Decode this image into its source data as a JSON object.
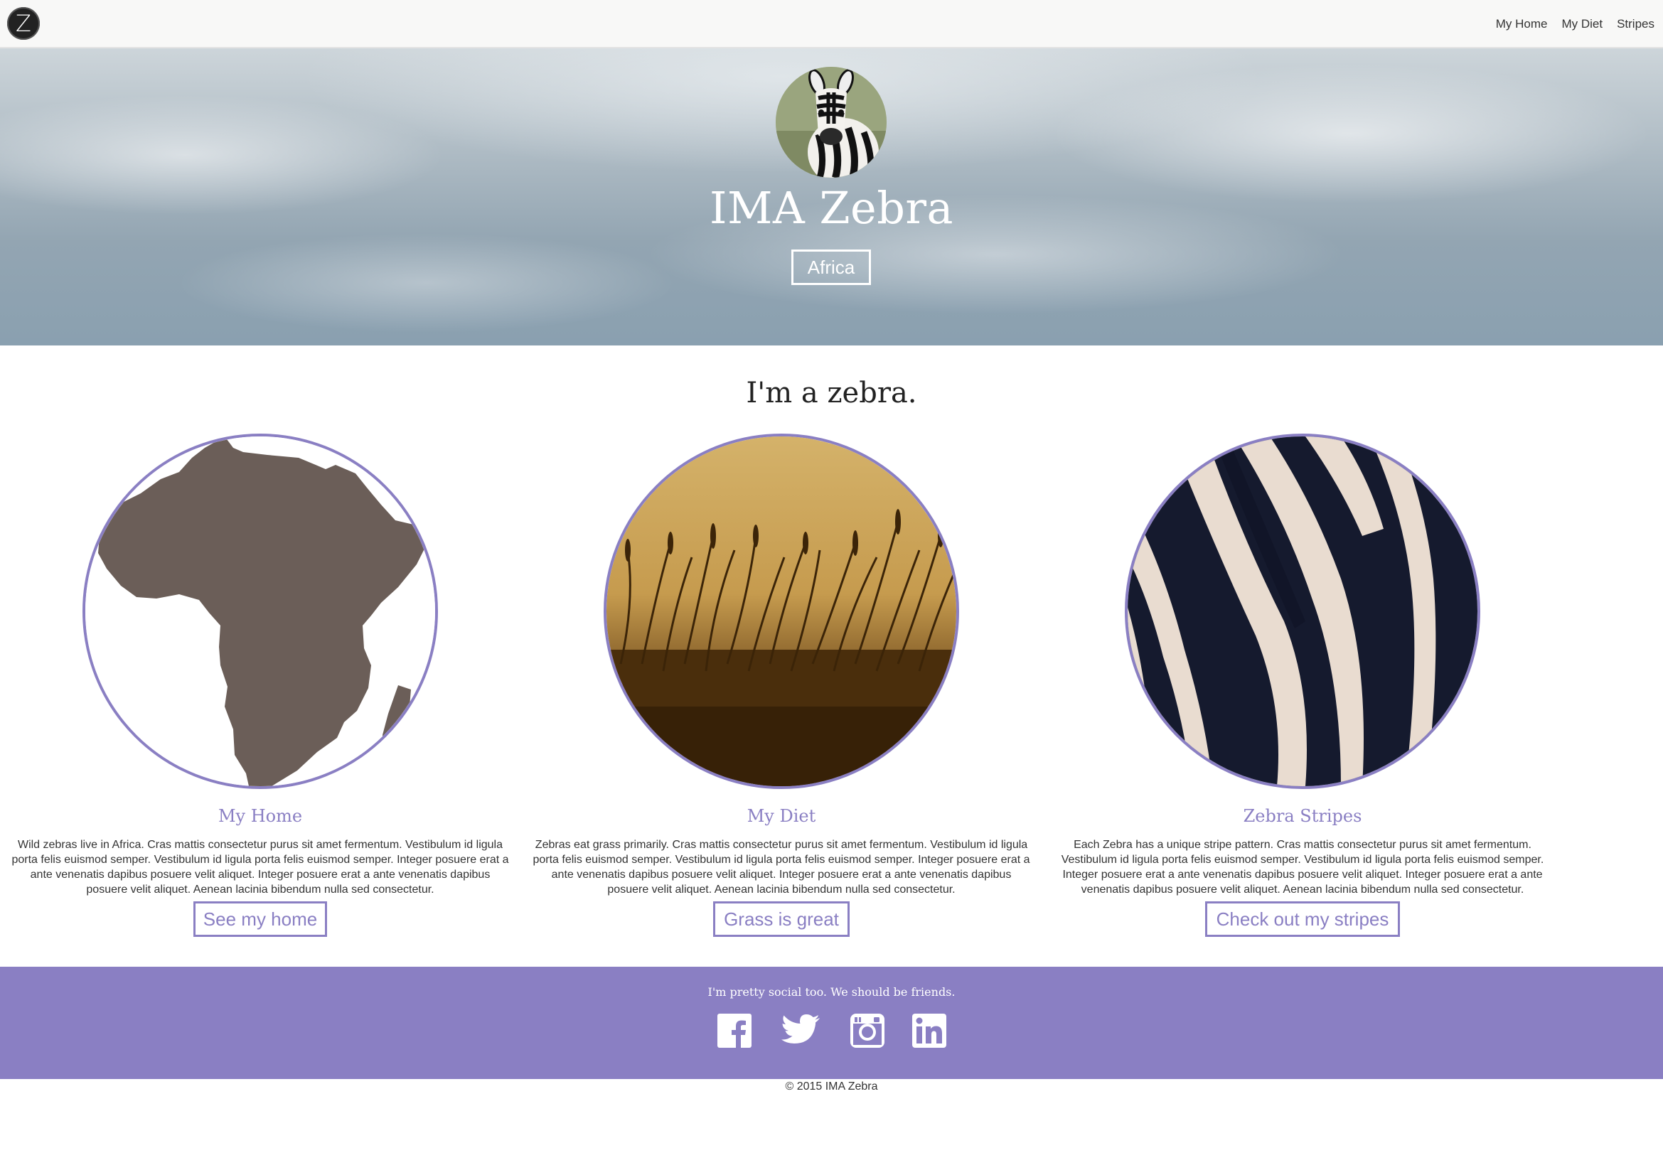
{
  "nav": {
    "logo_letter": "Z",
    "links": [
      "My Home",
      "My Diet",
      "Stripes"
    ]
  },
  "hero": {
    "avatar_icon": "zebra-portrait",
    "title": "IMA Zebra",
    "tag": "Africa"
  },
  "main": {
    "heading": "I'm a zebra.",
    "features": [
      {
        "image": "africa-map",
        "title": "My Home",
        "text": "Wild zebras live in Africa. Cras mattis consectetur purus sit amet fermentum. Vestibulum id ligula porta felis euismod semper. Vestibulum id ligula porta felis euismod semper. Integer posuere erat a ante venenatis dapibus posuere velit aliquet. Integer posuere erat a ante venenatis dapibus posuere velit aliquet. Aenean lacinia bibendum nulla sed consectetur.",
        "button": "See my home"
      },
      {
        "image": "savanna-grass",
        "title": "My Diet",
        "text": "Zebras eat grass primarily. Cras mattis consectetur purus sit amet fermentum. Vestibulum id ligula porta felis euismod semper. Vestibulum id ligula porta felis euismod semper. Integer posuere erat a ante venenatis dapibus posuere velit aliquet. Integer posuere erat a ante venenatis dapibus posuere velit aliquet. Aenean lacinia bibendum nulla sed consectetur.",
        "button": "Grass is great"
      },
      {
        "image": "zebra-stripes",
        "title": "Zebra Stripes",
        "text": "Each Zebra has a unique stripe pattern. Cras mattis consectetur purus sit amet fermentum. Vestibulum id ligula porta felis euismod semper. Vestibulum id ligula porta felis euismod semper. Integer posuere erat a ante venenatis dapibus posuere velit aliquet. Integer posuere erat a ante venenatis dapibus posuere velit aliquet. Aenean lacinia bibendum nulla sed consectetur.",
        "button": "Check out my stripes"
      }
    ]
  },
  "footer": {
    "tagline": "I'm pretty social too. We should be friends.",
    "social_icons": [
      "facebook-icon",
      "twitter-icon",
      "instagram-icon",
      "linkedin-icon"
    ],
    "copyright": "© 2015 IMA Zebra"
  },
  "colors": {
    "accent": "#8a7fc3",
    "footer_bg": "#8a7fc3",
    "africa_fill": "#6b5e58",
    "text": "#333333"
  }
}
